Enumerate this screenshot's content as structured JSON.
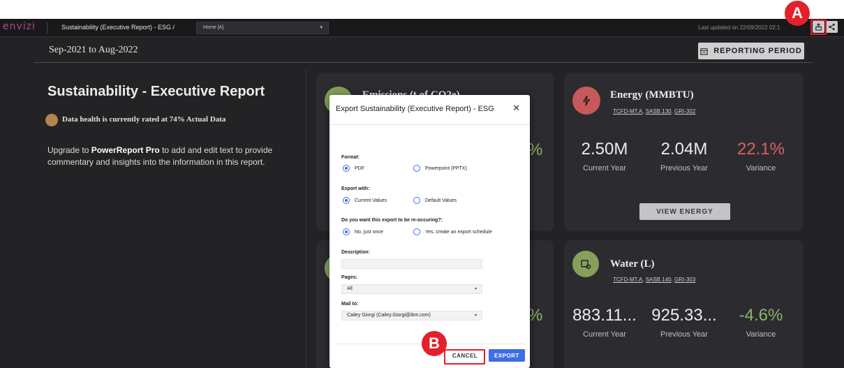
{
  "topbar": {
    "logo": "envizi",
    "breadcrumb": "Sustainability (Executive Report) - ESG  /",
    "page_select": "Home [A]",
    "last_updated": "Last updated on 22/09/2022 02:1"
  },
  "period": {
    "range": "Sep-2021 to Aug-2022",
    "button": "REPORTING PERIOD"
  },
  "report": {
    "title": "Sustainability - Executive Report",
    "health": "Data health is currently rated at 74% Actual Data",
    "upgrade_prefix": "Upgrade to ",
    "upgrade_product": "PowerReport Pro",
    "upgrade_suffix": " to add and edit text to provide commentary and insights into the information in this report."
  },
  "cards": {
    "emissions": {
      "title": "Emissions (t of CO2e)",
      "metric_fragment": "%"
    },
    "second_left": {
      "metric_fragment": "%"
    },
    "energy": {
      "title": "Energy (MMBTU)",
      "links": [
        "TCFD-MT.A",
        "SASB.130",
        "GRI-302"
      ],
      "current": "2.50M",
      "previous": "2.04M",
      "variance": "22.1%",
      "current_label": "Current Year",
      "previous_label": "Previous Year",
      "variance_label": "Variance",
      "button": "VIEW ENERGY",
      "icon_color": "#c8595a",
      "variance_color": "#d9625e"
    },
    "water": {
      "title": "Water (L)",
      "links": [
        "TCFD-MT.A",
        "SASB.140",
        "GRI-303"
      ],
      "current": "883.11...",
      "previous": "925.33...",
      "variance": "-4.6%",
      "current_label": "Current Year",
      "previous_label": "Previous Year",
      "variance_label": "Variance",
      "icon_color": "#86a05a",
      "variance_color": "#8fb26a"
    }
  },
  "modal": {
    "title": "Export Sustainability (Executive Report) - ESG",
    "format_label": "Format:",
    "format_options": [
      "PDF",
      "Powerpoint (PPTX)"
    ],
    "export_with_label": "Export with:",
    "export_with_options": [
      "Current Values",
      "Default Values"
    ],
    "recurring_label": "Do you want this export to be re-occuring?:",
    "recurring_options": [
      "No, just once",
      "Yes, create an export schedule"
    ],
    "description_label": "Description:",
    "description_value": "",
    "pages_label": "Pages:",
    "pages_value": "All",
    "mail_label": "Mail to:",
    "mail_value": "Cailey Giorgi (Cailey.Giorgi@ibm.com)",
    "cancel": "CANCEL",
    "export": "EXPORT"
  },
  "markers": {
    "a": "A",
    "b": "B"
  }
}
